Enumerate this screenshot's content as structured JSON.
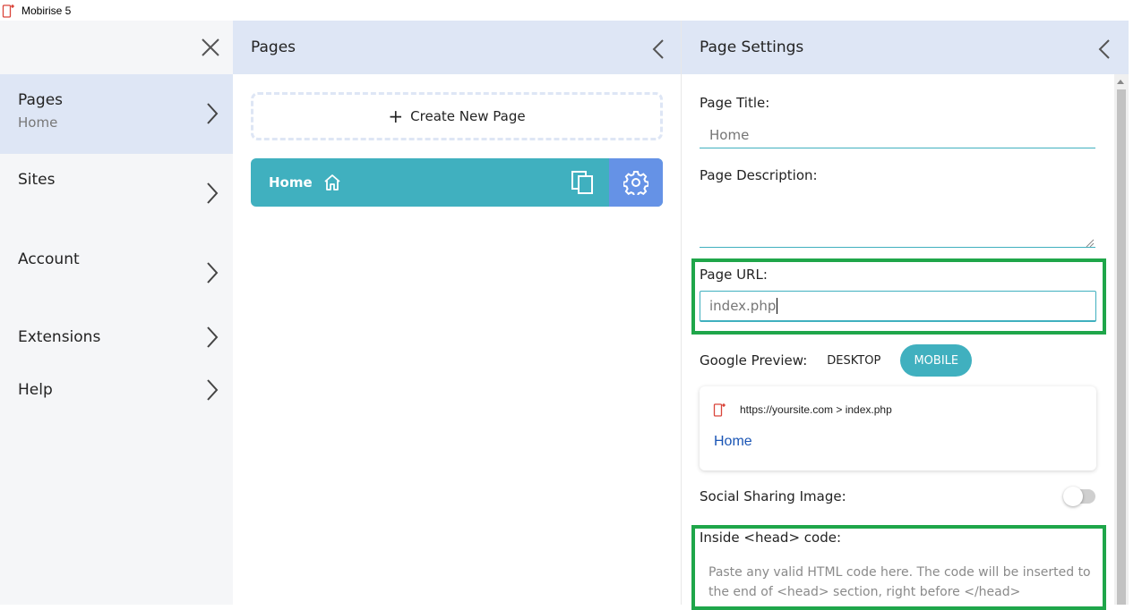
{
  "app": {
    "title": "Mobirise 5",
    "accent": "#40b0bf",
    "highlight_color": "#1fa64a"
  },
  "sidebar": {
    "items": [
      {
        "label": "Pages",
        "sub": "Home",
        "icon": "chevron-right-icon"
      },
      {
        "label": "Sites",
        "icon": "chevron-right-icon"
      },
      {
        "label": "Account",
        "icon": "chevron-right-icon"
      },
      {
        "label": "Extensions",
        "icon": "chevron-right-icon"
      },
      {
        "label": "Help",
        "icon": "chevron-right-icon"
      }
    ]
  },
  "pages_panel": {
    "title": "Pages",
    "create_label": "Create New Page",
    "pages": [
      {
        "name": "Home",
        "is_home": true
      }
    ]
  },
  "settings": {
    "title": "Page Settings",
    "page_title_label": "Page Title:",
    "page_title_placeholder": "Home",
    "page_description_label": "Page Description:",
    "page_url_label": "Page URL:",
    "page_url_value": "index.php",
    "google_preview_label": "Google Preview:",
    "tabs": [
      "DESKTOP",
      "MOBILE"
    ],
    "active_tab": "MOBILE",
    "preview_url": "https://yoursite.com > index.php",
    "preview_title": "Home",
    "social_sharing_label": "Social Sharing Image:",
    "social_sharing_enabled": false,
    "head_code_label": "Inside <head> code:",
    "head_code_placeholder": "Paste any valid HTML code here. The code will be inserted to the end of <head> section, right before </head>"
  }
}
